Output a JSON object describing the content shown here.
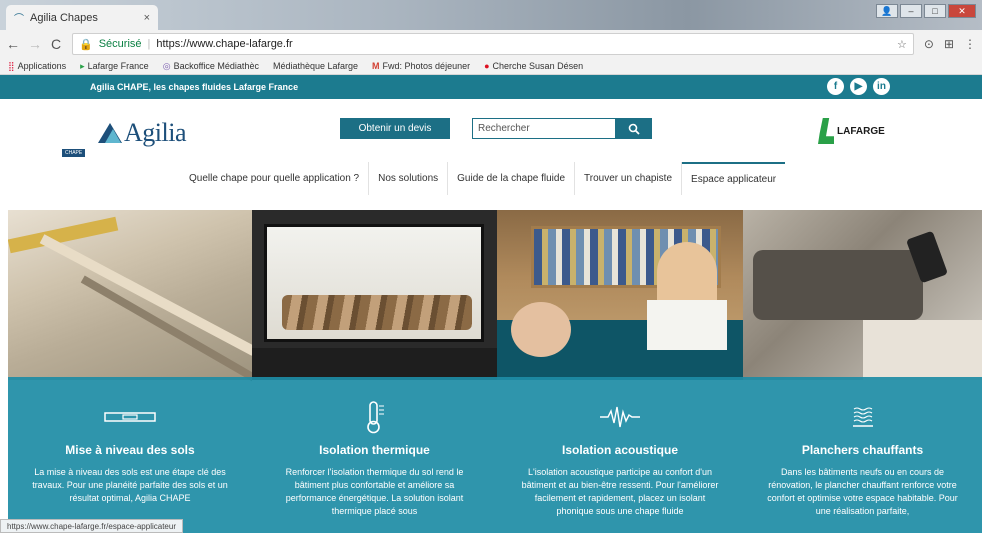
{
  "browser": {
    "tab_title": "Agilia Chapes",
    "tab_close": "×",
    "secure_label": "Sécurisé",
    "url": "https://www.chape-lafarge.fr",
    "bookmarks": [
      "Applications",
      "Lafarge France",
      "Backoffice Médiathèc",
      "Médiathèque Lafarge",
      "Fwd: Photos déjeuner",
      "Cherche Susan Désen"
    ]
  },
  "topbar": {
    "tagline": "Agilia CHAPE, les chapes fluides Lafarge France",
    "social": [
      "f",
      "▶",
      "in"
    ]
  },
  "header": {
    "logo_text": "Agilia",
    "logo_sub": "CHAPE",
    "cta_label": "Obtenir un devis",
    "search_placeholder": "Rechercher",
    "search_icon": "search-icon",
    "lafarge_text": "LAFARGE"
  },
  "nav": [
    "Quelle chape pour quelle application ?",
    "Nos solutions",
    "Guide de la chape fluide",
    "Trouver un chapiste",
    "Espace applicateur"
  ],
  "cards": [
    {
      "icon": "level-tool-icon",
      "title": "Mise à niveau des sols",
      "text": "La mise à niveau des sols est une étape clé des travaux. Pour une planéité parfaite des sols et un résultat optimal, Agilia CHAPE"
    },
    {
      "icon": "thermometer-icon",
      "title": "Isolation thermique",
      "text": "Renforcer l'isolation thermique du sol rend le bâtiment plus confortable et améliore sa performance énergétique. La solution isolant thermique placé sous"
    },
    {
      "icon": "sound-wave-icon",
      "title": "Isolation acoustique",
      "text": "L'isolation acoustique participe au confort d'un bâtiment et au bien-être ressenti. Pour l'améliorer facilement et rapidement, placez un isolant phonique sous une chape fluide"
    },
    {
      "icon": "heating-floor-icon",
      "title": "Planchers chauffants",
      "text": "Dans les bâtiments neufs ou en cours de rénovation, le plancher chauffant renforce votre confort et optimise votre espace habitable. Pour une réalisation parfaite,"
    }
  ],
  "status_url": "https://www.chape-lafarge.fr/espace-applicateur",
  "colors": {
    "brand_teal": "#1c7b8f",
    "overlay": "#1d8ca5",
    "lafarge_green": "#2aa048"
  }
}
